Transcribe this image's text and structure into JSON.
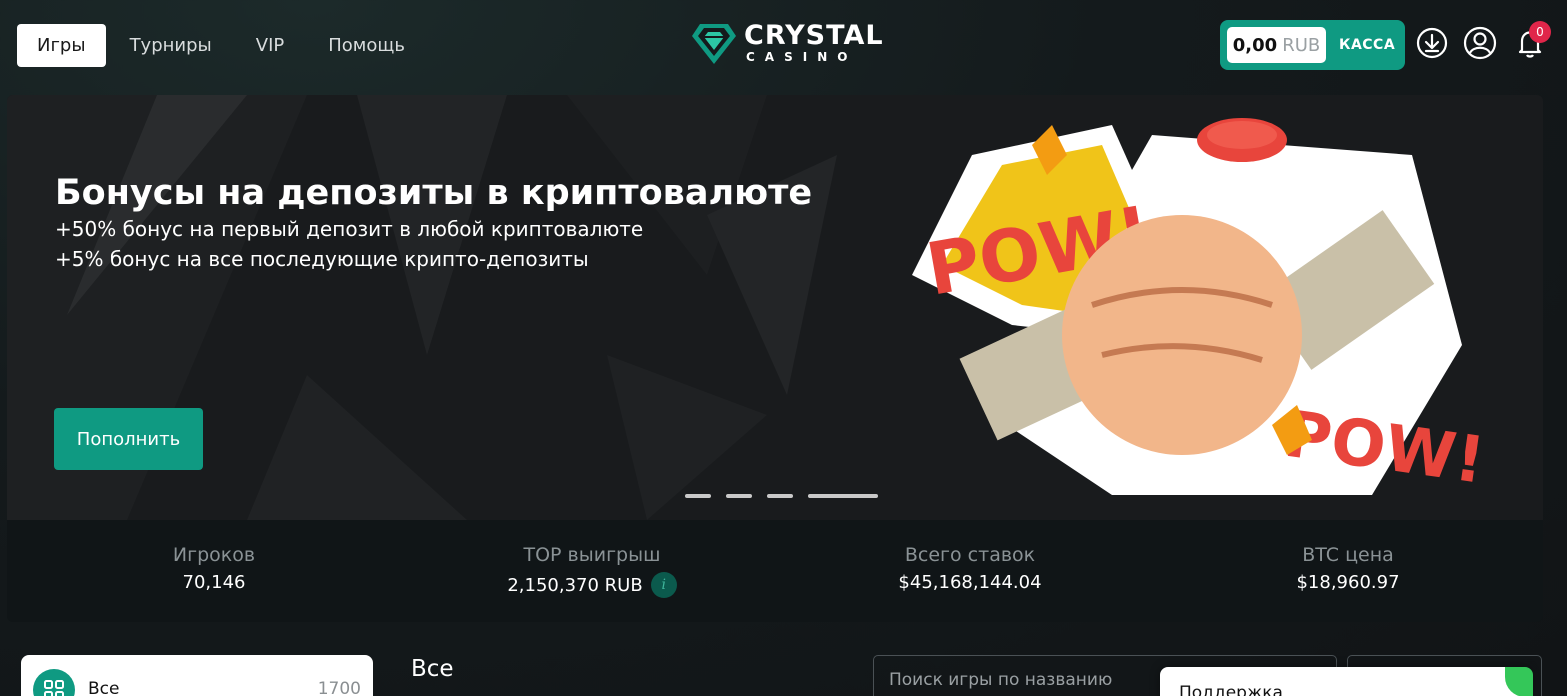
{
  "nav": {
    "items": [
      {
        "label": "Игры",
        "active": true
      },
      {
        "label": "Турниры",
        "active": false
      },
      {
        "label": "VIP",
        "active": false
      },
      {
        "label": "Помощь",
        "active": false
      }
    ]
  },
  "logo": {
    "word1": "CRYSTAL",
    "word2": "CASINO"
  },
  "wallet": {
    "amount": "0,00",
    "currency": "RUB",
    "cashier_label": "КАССА"
  },
  "header_icons": [
    "download-icon",
    "user-icon",
    "bell-icon"
  ],
  "notifications": {
    "count": "0"
  },
  "banner": {
    "title": "Бонусы на депозиты в криптовалюте",
    "line1": "+50% бонус на первый депозит в любой криптовалюте",
    "line2": "+5% бонус на все последующие крипто-депозиты",
    "button_label": "Пополнить",
    "slides": 4,
    "active_slide": 4
  },
  "stats": [
    {
      "label": "Игроков",
      "value": "70,146"
    },
    {
      "label": "TOP выигрыш",
      "value": "2,150,370 RUB",
      "info": "i"
    },
    {
      "label": "Всего ставок",
      "value": "$45,168,144.04"
    },
    {
      "label": "BTC цена",
      "value": "$18,960.97"
    }
  ],
  "categories": {
    "first": {
      "label": "Все",
      "count": "1700"
    }
  },
  "section_title": "Все",
  "search": {
    "placeholder": "Поиск игры по названию"
  },
  "support": {
    "label": "Поддержка"
  },
  "colors": {
    "accent": "#0f9a82",
    "badge": "#e0264a"
  }
}
